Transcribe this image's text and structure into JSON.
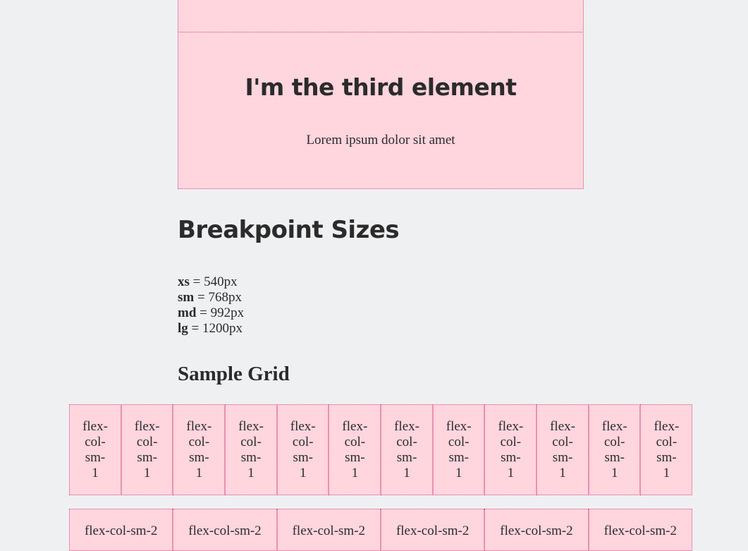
{
  "third_element": {
    "heading": "I'm the third element",
    "text": "Lorem ipsum dolor sit amet"
  },
  "breakpoints": {
    "title": "Breakpoint Sizes",
    "items": [
      {
        "key": "xs",
        "value": " = 540px"
      },
      {
        "key": "sm",
        "value": " = 768px"
      },
      {
        "key": "md",
        "value": " = 992px"
      },
      {
        "key": "lg",
        "value": " = 1200px"
      }
    ]
  },
  "sample_grid": {
    "title": "Sample Grid",
    "row1_cell_parts": [
      "flex-",
      "col-",
      "sm-",
      "1"
    ],
    "row1_count": 12,
    "row2_label": "flex-col-sm-2",
    "row2_count": 6
  },
  "colors": {
    "page_bg": "#eff0f2",
    "box_bg": "#ffd5de",
    "box_border": "#d04d86",
    "text": "#2b2b2b"
  }
}
